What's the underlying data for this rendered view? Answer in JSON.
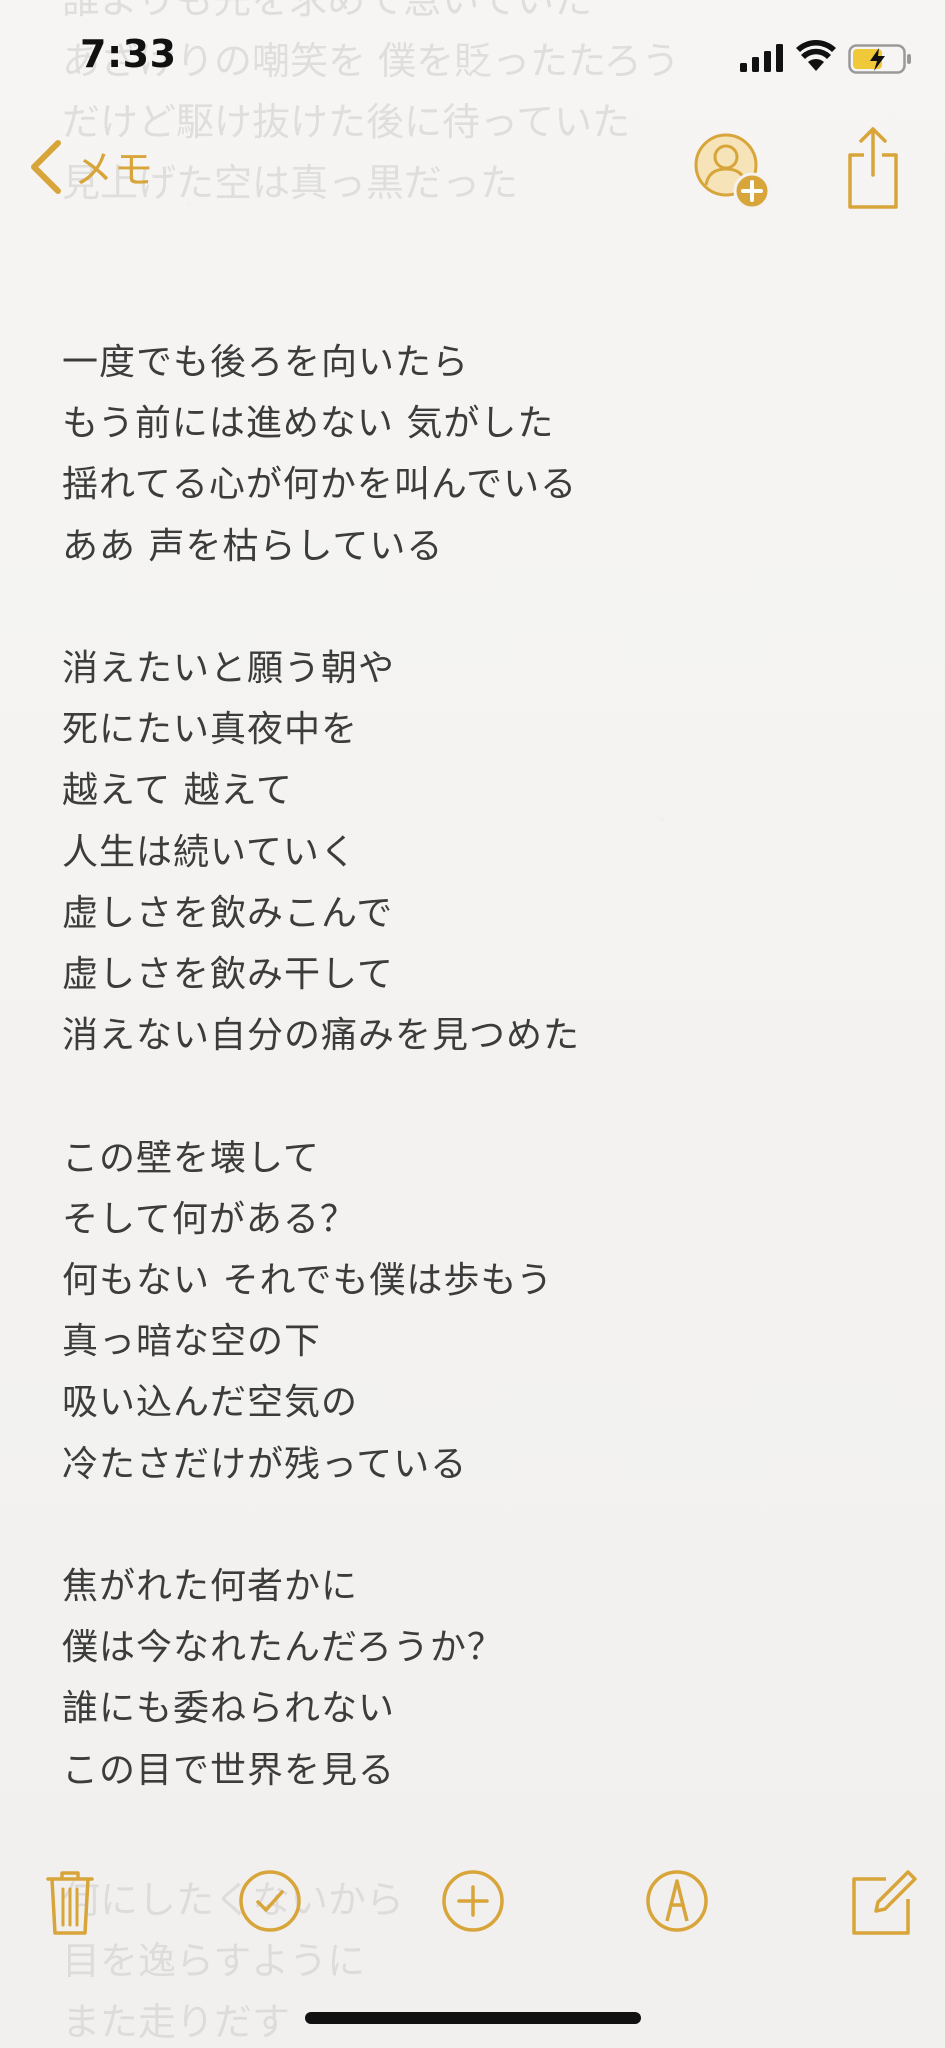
{
  "status_bar": {
    "time": "7:33"
  },
  "nav": {
    "back_label": "メモ",
    "icons": {
      "back": "chevron-left-icon",
      "collaborate": "add-person-icon",
      "share": "share-icon"
    }
  },
  "note": {
    "lines": [
      "一度でも後ろを向いたら",
      "もう前には進めない 気がした",
      "揺れてる心が何かを叫んでいる",
      "ああ 声を枯らしている",
      "",
      "消えたいと願う朝や",
      "死にたい真夜中を",
      "越えて 越えて",
      "人生は続いていく",
      "虚しさを飲みこんで",
      "虚しさを飲み干して",
      "消えない自分の痛みを見つめた",
      "",
      "この壁を壊して",
      "そして何がある？",
      "何もない それでも僕は歩もう",
      "真っ暗な空の下",
      "吸い込んだ空気の",
      "冷たさだけが残っている",
      "",
      "焦がれた何者かに",
      "僕は今なれたんだろうか？",
      "誰にも委ねられない",
      "この目で世界を見る"
    ],
    "faded_top_lines": [
      "誰よりも先を求めて急いでいた",
      "あざけりの嘲笑を 僕を貶ったたろう",
      "だけど駆け抜けた後に待っていた",
      "見上げた空は真っ黒だった"
    ],
    "faded_bottom_lines": [
      "何にしたくないから",
      "目を逸らすように",
      "また走りだす"
    ]
  },
  "toolbar": {
    "icons": [
      "trash-icon",
      "checklist-icon",
      "add-icon",
      "markup-icon",
      "compose-icon"
    ]
  },
  "colors": {
    "accent": "#D8A53A",
    "text": "#3C3C3C",
    "background": "#F4F3F1"
  }
}
